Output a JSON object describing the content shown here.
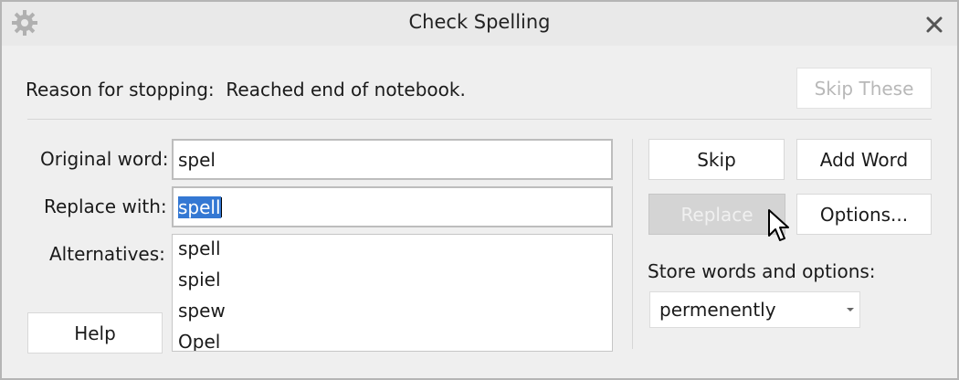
{
  "window": {
    "title": "Check Spelling",
    "icon": "gear-icon",
    "close_icon": "close-icon"
  },
  "status": {
    "reason_label": "Reason for stopping:",
    "reason_value": "Reached end of notebook.",
    "skip_these_label": "Skip These"
  },
  "form": {
    "original_label": "Original word:",
    "original_value": "spel",
    "replace_label": "Replace with:",
    "replace_value": "spell",
    "alternatives_label": "Alternatives:",
    "alternatives": [
      "spell",
      "spiel",
      "spew",
      "Opel"
    ]
  },
  "buttons": {
    "skip": "Skip",
    "add_word": "Add Word",
    "replace": "Replace",
    "options": "Options...",
    "help": "Help"
  },
  "store": {
    "label": "Store words and options:",
    "selected": "permenently"
  },
  "colors": {
    "selection": "#3478d3",
    "window_bg": "#efefef"
  }
}
